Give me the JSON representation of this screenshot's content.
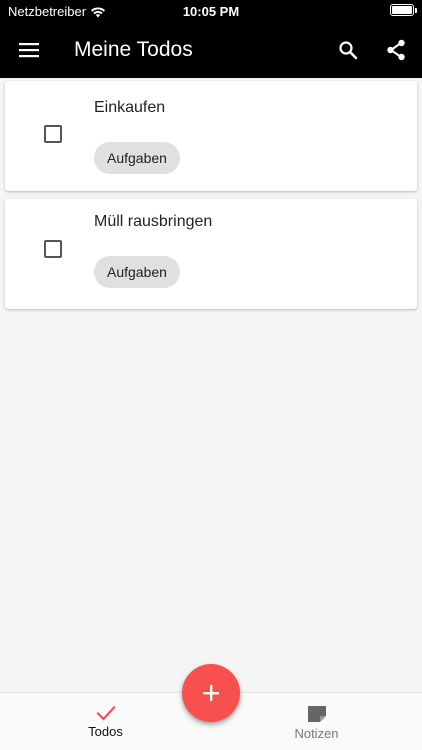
{
  "status_bar": {
    "carrier": "Netzbetreiber",
    "time": "10:05 PM",
    "icons": [
      "wifi-icon",
      "battery-icon"
    ]
  },
  "app_bar": {
    "title": "Meine Todos",
    "icons": [
      "menu-icon",
      "search-icon",
      "share-icon"
    ]
  },
  "todos": [
    {
      "title": "Einkaufen",
      "category": "Aufgaben",
      "checked": false
    },
    {
      "title": "Müll rausbringen",
      "category": "Aufgaben",
      "checked": false
    }
  ],
  "fab": {
    "icon": "add-icon",
    "color": "#f7504f"
  },
  "bottom_nav": {
    "items": [
      {
        "label": "Todos",
        "icon": "check-icon",
        "active": true
      },
      {
        "label": "Notizen",
        "icon": "note-icon",
        "active": false
      }
    ]
  },
  "colors": {
    "appbar_bg": "#000000",
    "accent": "#f7504f",
    "background": "#f5f5f5",
    "chip_bg": "#e0e0e0"
  }
}
